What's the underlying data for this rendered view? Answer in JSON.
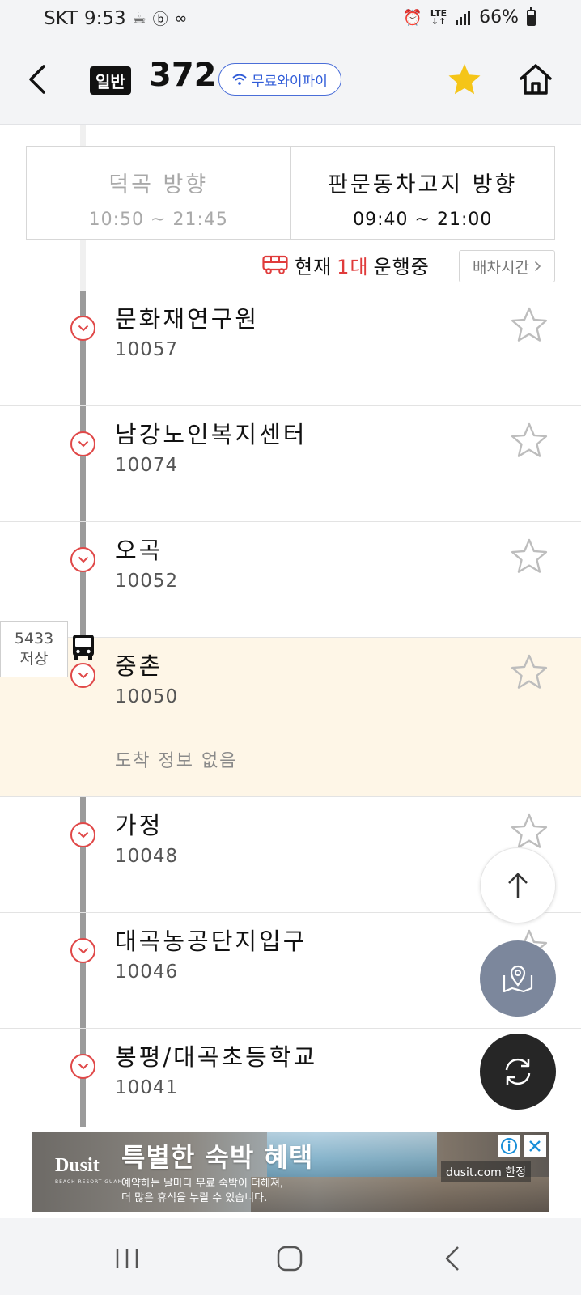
{
  "status_bar": {
    "carrier": "SKT",
    "time": "9:53",
    "network": "LTE",
    "battery": "66%"
  },
  "header": {
    "bus_type": "일반",
    "route_number": "372",
    "wifi_label": "무료와이파이"
  },
  "directions": [
    {
      "name": "덕곡 방향",
      "time": "10:50 ~ 21:45",
      "active": false
    },
    {
      "name": "판문동차고지 방향",
      "time": "09:40 ~ 21:00",
      "active": true
    }
  ],
  "operation": {
    "prefix": "현재",
    "count": "1대",
    "suffix": "운행중",
    "schedule_label": "배차시간"
  },
  "stops": [
    {
      "name": "문화재연구원",
      "id": "10057"
    },
    {
      "name": "남강노인복지센터",
      "id": "10074"
    },
    {
      "name": "오곡",
      "id": "10052"
    },
    {
      "name": "중촌",
      "id": "10050",
      "arrival": "도착 정보 없음",
      "current": true
    },
    {
      "name": "가정",
      "id": "10048"
    },
    {
      "name": "대곡농공단지입구",
      "id": "10046"
    },
    {
      "name": "봉평/대곡초등학교",
      "id": "10041"
    }
  ],
  "current_bus": {
    "plate": "5433",
    "floor_type": "저상"
  },
  "ad": {
    "brand": "Dusit",
    "brand_sub": "BEACH RESORT GUAM",
    "headline": "특별한 숙박 혜택",
    "line1": "예약하는 날마다 무료 숙박이 더해져,",
    "line2": "더 많은 휴식을 누릴 수 있습니다.",
    "domain": "dusit.com 한정"
  },
  "colors": {
    "accent_red": "#e04848",
    "wifi_blue": "#2f5bd8",
    "star_active": "#f5c518",
    "current_row_bg": "#fef6e7",
    "fab_map": "#7c879c",
    "fab_refresh": "#262626"
  }
}
